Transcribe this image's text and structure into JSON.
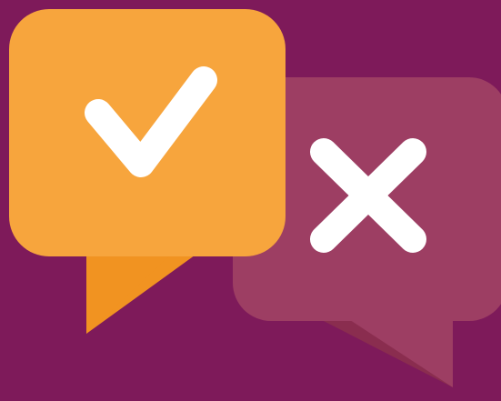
{
  "colors": {
    "background": "#7e1a5a",
    "yes_bubble": "#f7a53d",
    "yes_tail_shade": "#f19321",
    "no_bubble": "#9d3e63",
    "no_tail_shade": "#8a2d4f",
    "glyph": "#ffffff"
  },
  "icons": {
    "yes": "checkmark-icon",
    "no": "cross-icon"
  }
}
